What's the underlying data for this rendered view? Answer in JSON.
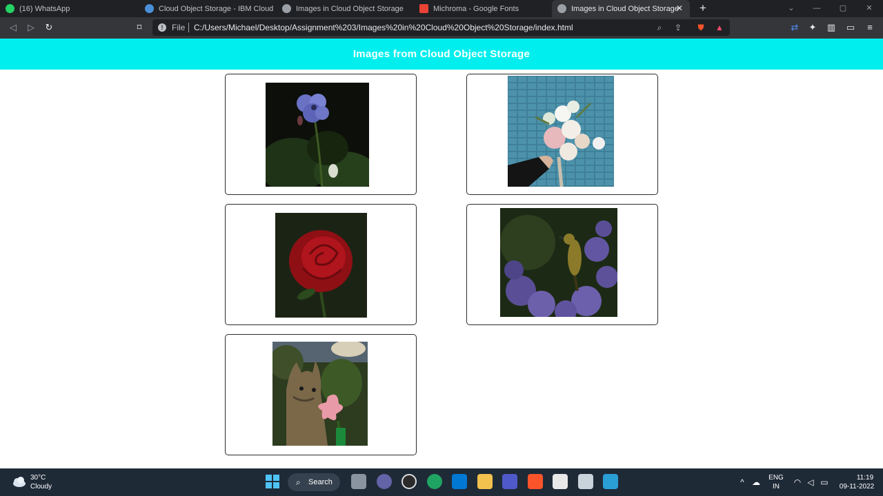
{
  "browser": {
    "tabs": [
      {
        "title": "(16) WhatsApp",
        "favicon": "whatsapp-icon",
        "color": "#25d366"
      },
      {
        "title": "Cloud Object Storage - IBM Cloud",
        "favicon": "ibm-cloud-icon",
        "color": "#4a90d9"
      },
      {
        "title": "Images in Cloud Object Storage",
        "favicon": "globe-icon",
        "color": "#9aa0a6"
      },
      {
        "title": "Michroma - Google Fonts",
        "favicon": "google-fonts-icon",
        "color": "#ea4335"
      },
      {
        "title": "Images in Cloud Object Storage",
        "favicon": "globe-icon",
        "color": "#9aa0a6"
      }
    ],
    "address": {
      "scheme_label": "File",
      "url": "C:/Users/Michael/Desktop/Assignment%203/Images%20in%20Cloud%20Object%20Storage/index.html"
    }
  },
  "page": {
    "title": "Images from Cloud Object Storage",
    "header_color": "#00efee",
    "images": [
      {
        "subject": "purple flower"
      },
      {
        "subject": "flower bouquet"
      },
      {
        "subject": "red rose"
      },
      {
        "subject": "bird on purple flowers"
      },
      {
        "subject": "cat with pink flower"
      }
    ]
  },
  "taskbar": {
    "weather": {
      "temp": "30°C",
      "condition": "Cloudy"
    },
    "search_label": "Search",
    "language": {
      "line1": "ENG",
      "line2": "IN"
    },
    "clock": {
      "time": "11:19",
      "date": "09-11-2022"
    }
  }
}
